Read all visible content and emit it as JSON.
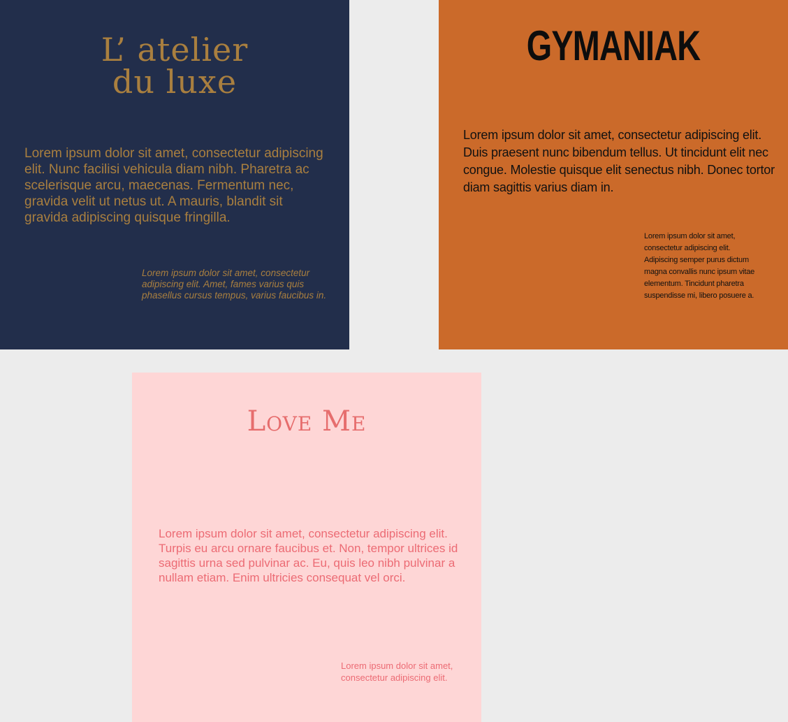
{
  "cards": [
    {
      "brand_line1": "L’ atelier",
      "brand_line2": "du luxe",
      "body": "Lorem ipsum dolor sit amet, consectetur adipiscing elit. Nunc facilisi vehicula diam nibh. Pharetra ac scelerisque arcu, maecenas. Fermentum nec, gravida velit ut netus ut. A mauris, blandit sit gravida adipiscing quisque fringilla.",
      "note": "Lorem ipsum dolor sit amet, consectetur adipiscing elit. Amet, fames varius quis phasellus cursus tempus, varius faucibus in.",
      "background": "#222e4b",
      "accent": "#a97f3f"
    },
    {
      "brand": "GYMANIAK",
      "body": "Lorem ipsum dolor sit amet, consectetur adipiscing elit. Duis praesent nunc bibendum tellus. Ut tincidunt elit nec congue. Molestie quisque elit senectus nibh. Donec tortor diam sagittis varius diam in.",
      "note": "Lorem ipsum dolor sit amet, consectetur adipiscing elit. Adipiscing semper purus dictum magna convallis nunc ipsum vitae elementum. Tincidunt pharetra suspendisse mi, libero posuere a.",
      "background": "#cb6a2a",
      "accent": "#0d0d0d"
    },
    {
      "brand": "Love Me",
      "body": "Lorem ipsum dolor sit amet, consectetur adipiscing elit. Turpis eu arcu ornare faucibus et. Non, tempor ultrices id sagittis urna sed pulvinar ac. Eu, quis leo nibh pulvinar a nullam etiam. Enim ultricies consequat vel orci.",
      "note": "Lorem ipsum dolor sit amet, consectetur adipiscing elit.",
      "background": "#fed6d6",
      "accent": "#ec6b74"
    }
  ],
  "page_background": "#ececec"
}
